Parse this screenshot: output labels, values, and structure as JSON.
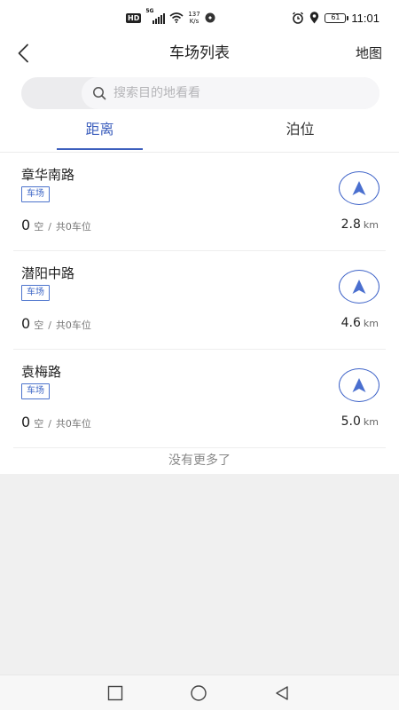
{
  "status_bar": {
    "hd_badge": "HD",
    "network": "5G",
    "speed_value": "137",
    "speed_unit": "K/s",
    "battery": "61",
    "time": "11:01"
  },
  "header": {
    "title": "车场列表",
    "map_link": "地图"
  },
  "search": {
    "placeholder": "搜索目的地看看"
  },
  "tabs": [
    {
      "label": "距离",
      "active": true
    },
    {
      "label": "泊位",
      "active": false
    }
  ],
  "list": {
    "items": [
      {
        "name": "章华南路",
        "tag": "车场",
        "free": "0",
        "free_label": "空",
        "sep": "/",
        "total_text": "共0车位",
        "distance": "2.8",
        "unit": "km"
      },
      {
        "name": "潜阳中路",
        "tag": "车场",
        "free": "0",
        "free_label": "空",
        "sep": "/",
        "total_text": "共0车位",
        "distance": "4.6",
        "unit": "km"
      },
      {
        "name": "袁梅路",
        "tag": "车场",
        "free": "0",
        "free_label": "空",
        "sep": "/",
        "total_text": "共0车位",
        "distance": "5.0",
        "unit": "km"
      }
    ],
    "footer": "没有更多了"
  },
  "colors": {
    "accent": "#3d5fbd",
    "tag_border": "#4c73cc",
    "nav_arrow": "#4a6fcf"
  },
  "icons": {
    "back": "chevron-left-icon",
    "search": "search-icon",
    "navigate": "navigation-arrow-icon",
    "recent_apps": "square-icon",
    "home": "circle-icon",
    "back_system": "triangle-left-icon"
  }
}
